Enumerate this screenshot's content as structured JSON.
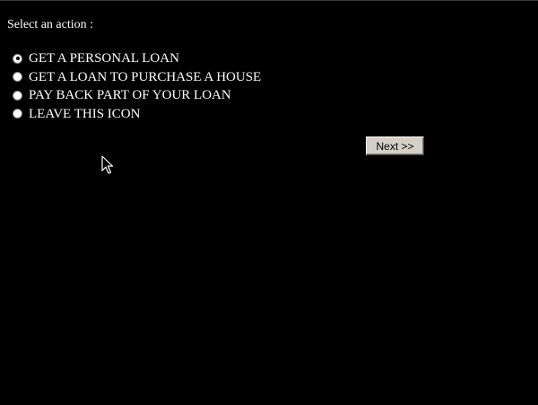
{
  "prompt": "Select an action :",
  "options": [
    {
      "label": "GET A PERSONAL LOAN",
      "selected": true
    },
    {
      "label": "GET A LOAN TO PURCHASE A HOUSE",
      "selected": false
    },
    {
      "label": "PAY BACK PART OF YOUR LOAN",
      "selected": false
    },
    {
      "label": "LEAVE THIS ICON",
      "selected": false
    }
  ],
  "next_button": {
    "label": "Next >>"
  },
  "colors": {
    "background": "#000000",
    "text": "#ffffff",
    "button_face": "#d4d0c8"
  },
  "icons": {
    "cursor": "arrow-cursor-icon"
  }
}
